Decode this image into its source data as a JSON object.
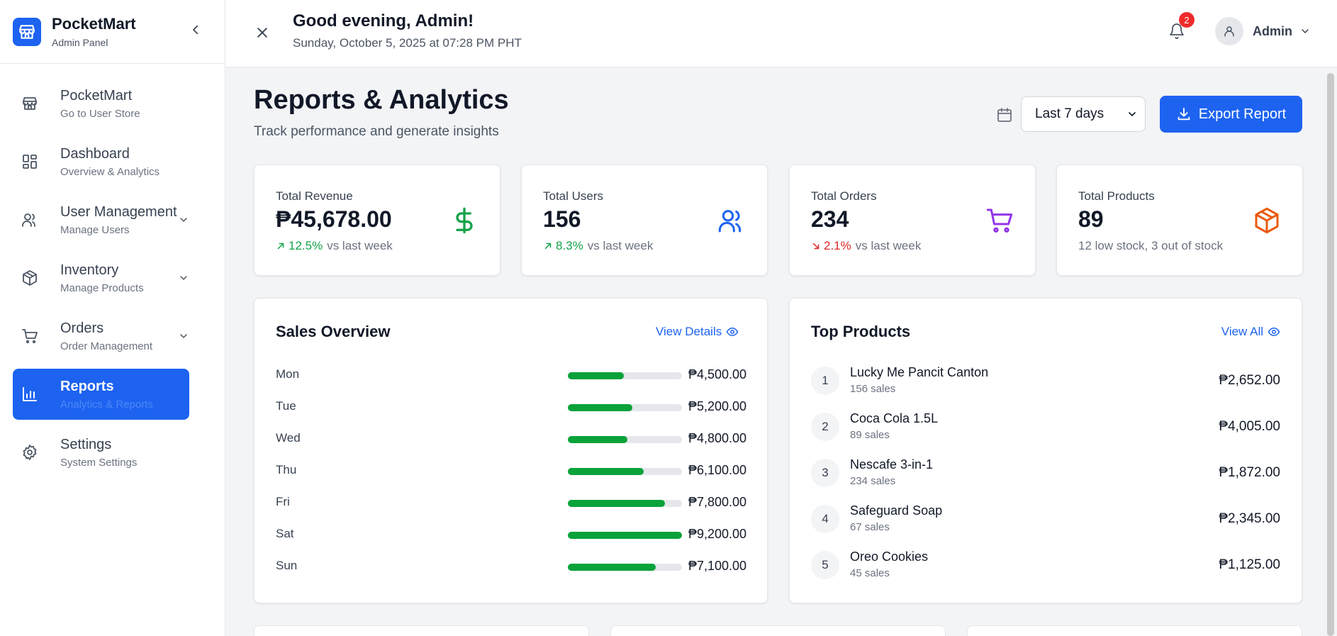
{
  "sidebar": {
    "brand": {
      "title": "PocketMart",
      "subtitle": "Admin Panel"
    },
    "items": [
      {
        "label": "PocketMart",
        "sub": "Go to User Store"
      },
      {
        "label": "Dashboard",
        "sub": "Overview & Analytics"
      },
      {
        "label": "User Management",
        "sub": "Manage Users"
      },
      {
        "label": "Inventory",
        "sub": "Manage Products"
      },
      {
        "label": "Orders",
        "sub": "Order Management"
      },
      {
        "label": "Reports",
        "sub": "Analytics & Reports"
      },
      {
        "label": "Settings",
        "sub": "System Settings"
      }
    ]
  },
  "header": {
    "greeting": "Good evening, Admin!",
    "datetime": "Sunday, October 5, 2025 at 07:28 PM PHT",
    "notifications": "2",
    "user": "Admin"
  },
  "page": {
    "title": "Reports & Analytics",
    "subtitle": "Track performance and generate insights",
    "range": "Last 7 days",
    "export_label": "Export Report"
  },
  "stats": [
    {
      "label": "Total Revenue",
      "value": "₱45,678.00",
      "change": "12.5%",
      "change_dir": "up",
      "foot": "vs last week"
    },
    {
      "label": "Total Users",
      "value": "156",
      "change": "8.3%",
      "change_dir": "up",
      "foot": "vs last week"
    },
    {
      "label": "Total Orders",
      "value": "234",
      "change": "2.1%",
      "change_dir": "down",
      "foot": "vs last week"
    },
    {
      "label": "Total Products",
      "value": "89",
      "foot": "12 low stock, 3 out of stock"
    }
  ],
  "sales": {
    "title": "Sales Overview",
    "link": "View Details",
    "rows": [
      {
        "day": "Mon",
        "amount": "₱4,500.00",
        "value": 4500
      },
      {
        "day": "Tue",
        "amount": "₱5,200.00",
        "value": 5200
      },
      {
        "day": "Wed",
        "amount": "₱4,800.00",
        "value": 4800
      },
      {
        "day": "Thu",
        "amount": "₱6,100.00",
        "value": 6100
      },
      {
        "day": "Fri",
        "amount": "₱7,800.00",
        "value": 7800
      },
      {
        "day": "Sat",
        "amount": "₱9,200.00",
        "value": 9200
      },
      {
        "day": "Sun",
        "amount": "₱7,100.00",
        "value": 7100
      }
    ]
  },
  "top_products": {
    "title": "Top Products",
    "link": "View All",
    "items": [
      {
        "rank": "1",
        "name": "Lucky Me Pancit Canton",
        "sales": "156 sales",
        "price": "₱2,652.00"
      },
      {
        "rank": "2",
        "name": "Coca Cola 1.5L",
        "sales": "89 sales",
        "price": "₱4,005.00"
      },
      {
        "rank": "3",
        "name": "Nescafe 3-in-1",
        "sales": "234 sales",
        "price": "₱1,872.00"
      },
      {
        "rank": "4",
        "name": "Safeguard Soap",
        "sales": "67 sales",
        "price": "₱2,345.00"
      },
      {
        "rank": "5",
        "name": "Oreo Cookies",
        "sales": "45 sales",
        "price": "₱1,125.00"
      }
    ]
  },
  "colors": {
    "accent": "#1d63f0",
    "positive": "#16a34a",
    "negative": "#dc2626",
    "bar": "#0aa23a"
  }
}
